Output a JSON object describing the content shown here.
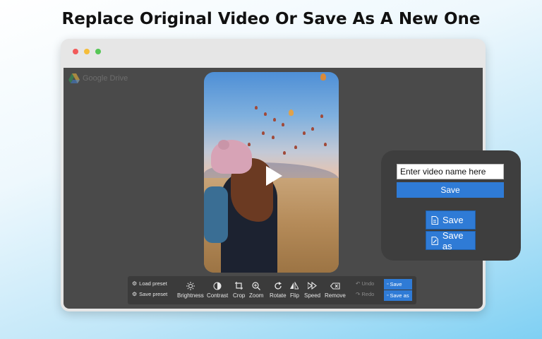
{
  "headline": "Replace Original Video Or Save As A New One",
  "window": {
    "dots": [
      "#f25a5a",
      "#f5bd3a",
      "#56c656"
    ],
    "brand": "Google Drive"
  },
  "toolbar": {
    "load_preset": "Load preset",
    "save_preset": "Save preset",
    "tools": [
      {
        "label": "Brightness",
        "icon": "brightness-icon"
      },
      {
        "label": "Contrast",
        "icon": "contrast-icon"
      },
      {
        "label": "Crop",
        "icon": "crop-icon"
      },
      {
        "label": "Zoom",
        "icon": "zoom-icon"
      },
      {
        "label": "Rotate",
        "icon": "rotate-icon"
      },
      {
        "label": "Flip",
        "icon": "flip-icon"
      },
      {
        "label": "Speed",
        "icon": "speed-icon"
      },
      {
        "label": "Remove",
        "icon": "remove-icon"
      }
    ],
    "undo": "Undo",
    "redo": "Redo",
    "save": "Save",
    "save_as": "Save as"
  },
  "panel": {
    "input_placeholder": "Enter video name here",
    "save_label": "Save",
    "save_button": "Save",
    "save_as_button": "Save as"
  },
  "colors": {
    "accent": "#2f7bd6",
    "panel_bg": "#3e3e3e",
    "viewport_bg": "#4a4a4a"
  }
}
